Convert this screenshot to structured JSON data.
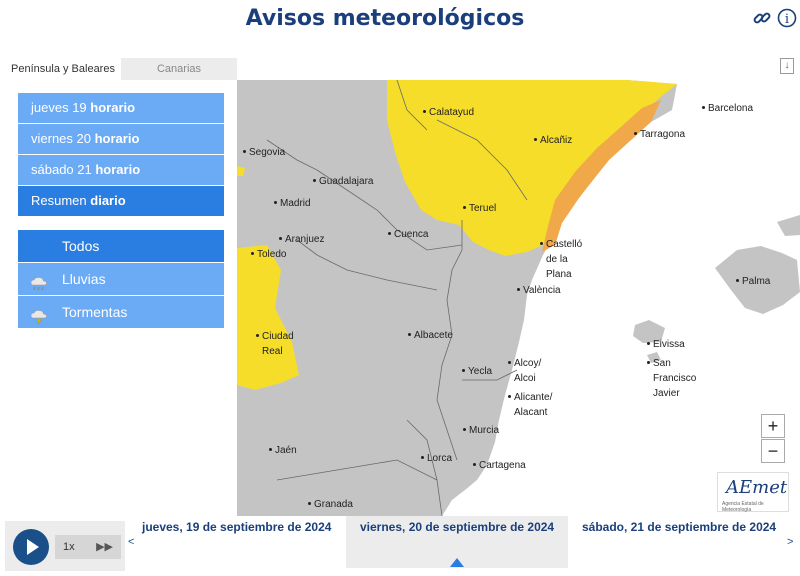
{
  "header": {
    "title": "Avisos meteorológicos"
  },
  "tabs": [
    {
      "label": "Península y Baleares",
      "active": true
    },
    {
      "label": "Canarias",
      "active": false
    }
  ],
  "days": [
    {
      "day": "jueves 19",
      "mode": "horario",
      "active": false
    },
    {
      "day": "viernes 20",
      "mode": "horario",
      "active": false
    },
    {
      "day": "sábado 21",
      "mode": "horario",
      "active": false
    },
    {
      "day": "Resumen",
      "mode": "diario",
      "active": true
    }
  ],
  "warning_types": [
    {
      "label": "Todos",
      "icon": "none",
      "active": true
    },
    {
      "label": "Lluvias",
      "icon": "rain-icon",
      "active": false
    },
    {
      "label": "Tormentas",
      "icon": "storm-icon",
      "active": false
    }
  ],
  "map": {
    "colors": {
      "land": "#c4c4c4",
      "sea": "#ffffff",
      "yellow": "#f5dd2a",
      "orange": "#f0a848"
    },
    "places": [
      "Calatayud",
      "Barcelona",
      "Alcañiz",
      "Tarragona",
      "Segovia",
      "Guadalajara",
      "Madrid",
      "Teruel",
      "Aranjuez",
      "Cuenca",
      "Castelló",
      "de la",
      "Plana",
      "Toledo",
      "València",
      "Palma",
      "Eivissa",
      "Ciudad",
      "Real",
      "Albacete",
      "San",
      "Francisco",
      "Javier",
      "Alcoy/",
      "Alcoi",
      "Yecla",
      "Alicante/",
      "Alacant",
      "Murcia",
      "Jaén",
      "Lorca",
      "Cartagena",
      "Granada"
    ],
    "zoom_in": "+",
    "zoom_out": "−",
    "logo": "AEmet",
    "logo_sub": "Agencia Estatal de Meteorología"
  },
  "timeline": {
    "speed": "1x",
    "prev": "<",
    "next": ">",
    "dates": [
      {
        "label": "jueves, 19 de septiembre de 2024",
        "active": false
      },
      {
        "label": "viernes, 20 de septiembre de 2024",
        "active": true
      },
      {
        "label": "sábado, 21 de septiembre de 2024",
        "active": false
      }
    ]
  }
}
